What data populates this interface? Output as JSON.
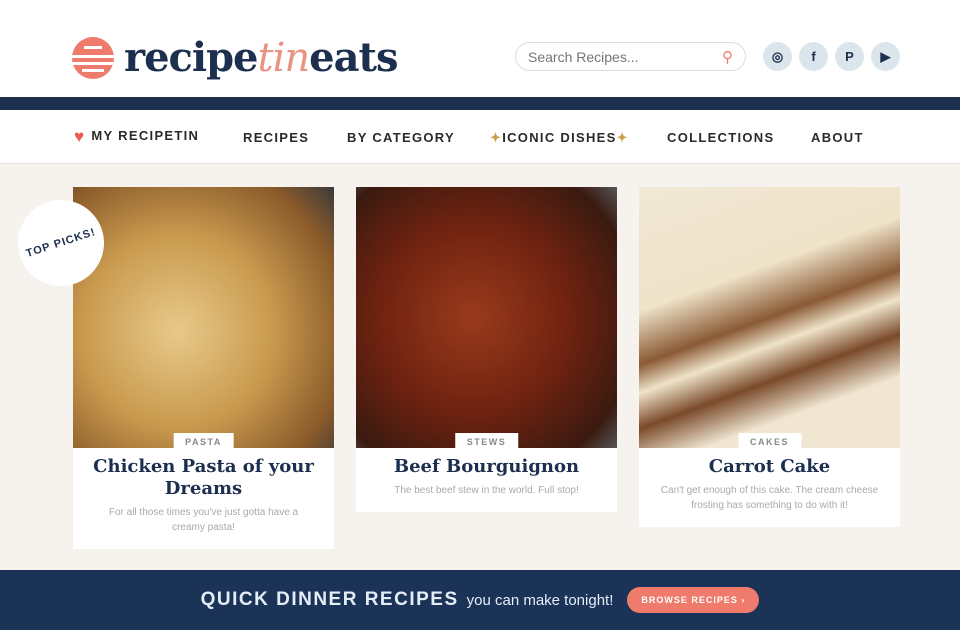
{
  "header": {
    "logo_a": "recipe",
    "logo_b": "tin",
    "logo_c": "eats",
    "search_placeholder": "Search Recipes...",
    "social": [
      "instagram",
      "facebook",
      "pinterest",
      "youtube"
    ],
    "social_glyphs": [
      "◎",
      "f",
      "P",
      "▶"
    ]
  },
  "nav": {
    "items": [
      "MY RECIPETIN",
      "RECIPES",
      "BY CATEGORY",
      "ICONIC DISHES",
      "COLLECTIONS",
      "ABOUT"
    ],
    "spark": "✨"
  },
  "badge": "TOP PICKS!",
  "cards": [
    {
      "tag": "PASTA",
      "title": "Chicken Pasta of your Dreams",
      "desc": "For all those times you've just gotta have a creamy pasta!"
    },
    {
      "tag": "STEWS",
      "title": "Beef Bourguignon",
      "desc": "The best beef stew in the world. Full stop!"
    },
    {
      "tag": "CAKES",
      "title": "Carrot Cake",
      "desc": "Can't get enough of this cake. The cream cheese frosting has something to do with it!"
    }
  ],
  "banner": {
    "title": "QUICK DINNER RECIPES",
    "sub": "you can make tonight!",
    "button": "BROWSE RECIPES ›"
  }
}
